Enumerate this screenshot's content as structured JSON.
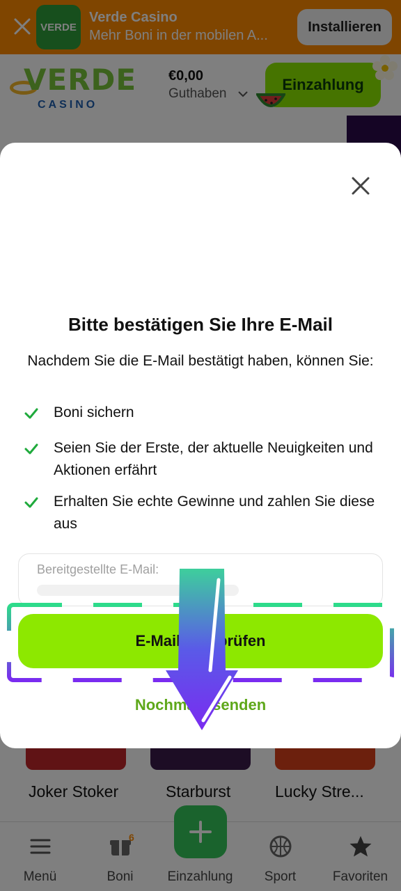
{
  "install_banner": {
    "logo_text": "VERDE",
    "title": "Verde Casino",
    "subtitle": "Mehr Boni in der mobilen A...",
    "install_label": "Installieren"
  },
  "header": {
    "logo_main": "VERDE",
    "logo_sub": "CASINO",
    "balance_amount": "€0,00",
    "balance_label": "Guthaben",
    "deposit_label": "Einzahlung"
  },
  "games": [
    {
      "name": "Joker Stoker",
      "thumb_color": "#c0262a"
    },
    {
      "name": "Starburst",
      "thumb_color": "#3a1a4a"
    },
    {
      "name": "Lucky Stre...",
      "thumb_color": "#d8401a"
    }
  ],
  "bottom_nav": {
    "items": [
      {
        "label": "Menü",
        "icon": "menu-icon"
      },
      {
        "label": "Boni",
        "icon": "gift-icon",
        "badge": "6"
      },
      {
        "label": "Einzahlung",
        "icon": "plus-icon"
      },
      {
        "label": "Sport",
        "icon": "basketball-icon"
      },
      {
        "label": "Favoriten",
        "icon": "star-icon"
      }
    ]
  },
  "modal": {
    "title": "Bitte bestätigen Sie Ihre E-Mail",
    "intro": "Nachdem Sie die E-Mail bestätigt haben, können Sie:",
    "benefits": [
      "Boni sichern",
      "Seien Sie der Erste, der aktuelle Neuigkeiten und Aktionen erfährt",
      "Erhalten Sie echte Gewinne und zahlen Sie diese aus"
    ],
    "email_label": "Bereitgestellte E-Mail:",
    "verify_label": "E-Mail überprüfen",
    "resend_label": "Nochmals senden"
  },
  "colors": {
    "banner": "#ff8a00",
    "accent_green": "#8de800",
    "link_green": "#5ea81a",
    "check_green": "#1faa3c"
  }
}
